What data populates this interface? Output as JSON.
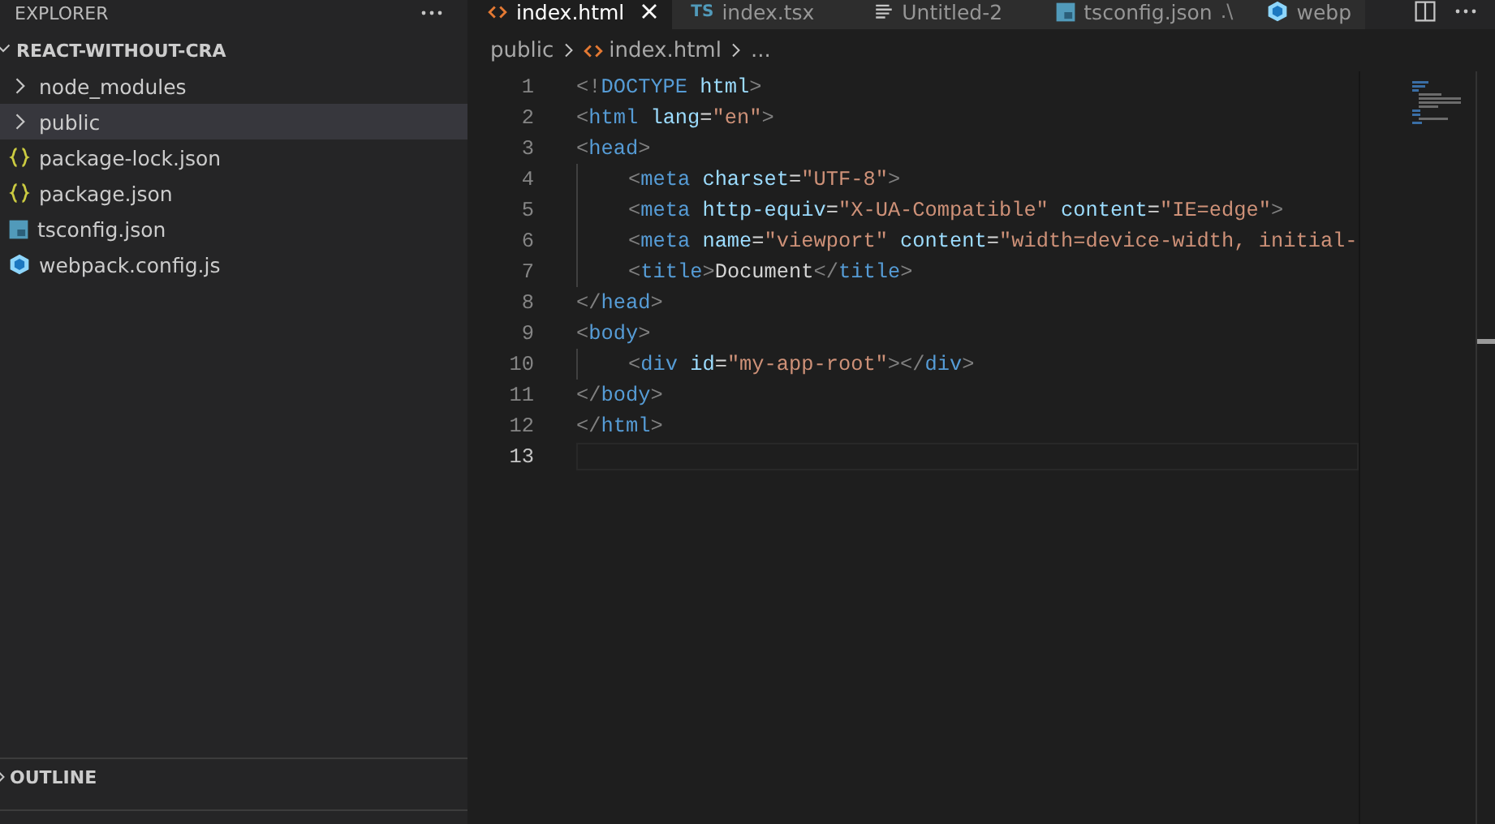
{
  "sidebar": {
    "title": "EXPLORER",
    "root": {
      "label": "REACT-WITHOUT-CRA",
      "expanded": true
    },
    "items": [
      {
        "label": "node_modules",
        "kind": "folder",
        "selected": false
      },
      {
        "label": "public",
        "kind": "folder",
        "selected": true
      },
      {
        "label": "package-lock.json",
        "kind": "json",
        "selected": false
      },
      {
        "label": "package.json",
        "kind": "json",
        "selected": false
      },
      {
        "label": "tsconfig.json",
        "kind": "tsconfig",
        "selected": false
      },
      {
        "label": "webpack.config.js",
        "kind": "webpack",
        "selected": false
      }
    ],
    "sections": [
      {
        "label": "OUTLINE",
        "expanded": false
      }
    ]
  },
  "tabs": [
    {
      "label": "index.html",
      "kind": "html",
      "selected": true
    },
    {
      "label": "index.tsx",
      "kind": "ts",
      "icon_text": "TS",
      "selected": false
    },
    {
      "label": "Untitled-2",
      "kind": "text",
      "selected": false
    },
    {
      "label": "tsconfig.json",
      "kind": "tsconfig",
      "description": ".\\",
      "selected": false
    },
    {
      "label": "webp",
      "kind": "webpack",
      "selected": false
    }
  ],
  "breadcrumb": [
    "public",
    "index.html",
    "..."
  ],
  "editor": {
    "lines": [
      {
        "number": "1",
        "indented": false,
        "selected": false,
        "tokens": [
          {
            "text": "<!",
            "kind": "punct"
          },
          {
            "text": "DOCTYPE",
            "kind": "tag"
          },
          {
            "text": " html",
            "kind": "attr"
          },
          {
            "text": ">",
            "kind": "punct"
          }
        ]
      },
      {
        "number": "2",
        "indented": false,
        "selected": false,
        "tokens": [
          {
            "text": "<",
            "kind": "punct"
          },
          {
            "text": "html",
            "kind": "tag"
          },
          {
            "text": " lang",
            "kind": "attr"
          },
          {
            "text": "=",
            "kind": "text"
          },
          {
            "text": "\"en\"",
            "kind": "str"
          },
          {
            "text": ">",
            "kind": "punct"
          }
        ]
      },
      {
        "number": "3",
        "indented": false,
        "selected": false,
        "tokens": [
          {
            "text": "<",
            "kind": "punct"
          },
          {
            "text": "head",
            "kind": "tag"
          },
          {
            "text": ">",
            "kind": "punct"
          }
        ]
      },
      {
        "number": "4",
        "indented": true,
        "selected": false,
        "tokens": [
          {
            "text": "<",
            "kind": "punct"
          },
          {
            "text": "meta",
            "kind": "tag"
          },
          {
            "text": " charset",
            "kind": "attr"
          },
          {
            "text": "=",
            "kind": "text"
          },
          {
            "text": "\"UTF-8\"",
            "kind": "str"
          },
          {
            "text": ">",
            "kind": "punct"
          }
        ]
      },
      {
        "number": "5",
        "indented": true,
        "selected": false,
        "tokens": [
          {
            "text": "<",
            "kind": "punct"
          },
          {
            "text": "meta",
            "kind": "tag"
          },
          {
            "text": " http-equiv",
            "kind": "attr"
          },
          {
            "text": "=",
            "kind": "text"
          },
          {
            "text": "\"X-UA-Compatible\"",
            "kind": "str"
          },
          {
            "text": " content",
            "kind": "attr"
          },
          {
            "text": "=",
            "kind": "text"
          },
          {
            "text": "\"IE=edge\"",
            "kind": "str"
          },
          {
            "text": ">",
            "kind": "punct"
          }
        ]
      },
      {
        "number": "6",
        "indented": true,
        "selected": false,
        "tokens": [
          {
            "text": "<",
            "kind": "punct"
          },
          {
            "text": "meta",
            "kind": "tag"
          },
          {
            "text": " name",
            "kind": "attr"
          },
          {
            "text": "=",
            "kind": "text"
          },
          {
            "text": "\"viewport\"",
            "kind": "str"
          },
          {
            "text": " content",
            "kind": "attr"
          },
          {
            "text": "=",
            "kind": "text"
          },
          {
            "text": "\"width=device-width, initial-",
            "kind": "str"
          }
        ]
      },
      {
        "number": "7",
        "indented": true,
        "selected": false,
        "tokens": [
          {
            "text": "<",
            "kind": "punct"
          },
          {
            "text": "title",
            "kind": "tag"
          },
          {
            "text": ">",
            "kind": "punct"
          },
          {
            "text": "Document",
            "kind": "text"
          },
          {
            "text": "</",
            "kind": "punct"
          },
          {
            "text": "title",
            "kind": "tag"
          },
          {
            "text": ">",
            "kind": "punct"
          }
        ]
      },
      {
        "number": "8",
        "indented": false,
        "selected": false,
        "tokens": [
          {
            "text": "</",
            "kind": "punct"
          },
          {
            "text": "head",
            "kind": "tag"
          },
          {
            "text": ">",
            "kind": "punct"
          }
        ]
      },
      {
        "number": "9",
        "indented": false,
        "selected": false,
        "tokens": [
          {
            "text": "<",
            "kind": "punct"
          },
          {
            "text": "body",
            "kind": "tag"
          },
          {
            "text": ">",
            "kind": "punct"
          }
        ]
      },
      {
        "number": "10",
        "indented": true,
        "selected": false,
        "tokens": [
          {
            "text": "<",
            "kind": "punct"
          },
          {
            "text": "div",
            "kind": "tag"
          },
          {
            "text": " id",
            "kind": "attr"
          },
          {
            "text": "=",
            "kind": "text"
          },
          {
            "text": "\"my-app-root\"",
            "kind": "str"
          },
          {
            "text": "></",
            "kind": "punct"
          },
          {
            "text": "div",
            "kind": "tag"
          },
          {
            "text": ">",
            "kind": "punct"
          }
        ]
      },
      {
        "number": "11",
        "indented": false,
        "selected": false,
        "tokens": [
          {
            "text": "</",
            "kind": "punct"
          },
          {
            "text": "body",
            "kind": "tag"
          },
          {
            "text": ">",
            "kind": "punct"
          }
        ]
      },
      {
        "number": "12",
        "indented": false,
        "selected": false,
        "tokens": [
          {
            "text": "</",
            "kind": "punct"
          },
          {
            "text": "html",
            "kind": "tag"
          },
          {
            "text": ">",
            "kind": "punct"
          }
        ]
      },
      {
        "number": "13",
        "indented": false,
        "selected": true
      }
    ]
  }
}
